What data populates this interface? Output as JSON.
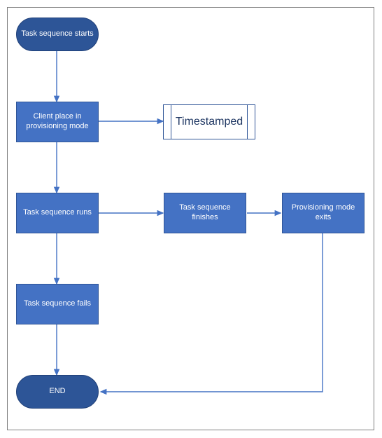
{
  "chart_data": {
    "type": "flowchart",
    "title": "",
    "nodes": [
      {
        "id": "start",
        "shape": "terminator",
        "label": "Task sequence starts"
      },
      {
        "id": "client",
        "shape": "process",
        "label": "Client place in provisioning mode"
      },
      {
        "id": "timestamp",
        "shape": "data",
        "label": "Timestamped"
      },
      {
        "id": "runs",
        "shape": "process",
        "label": "Task sequence runs"
      },
      {
        "id": "finishes",
        "shape": "process",
        "label": "Task sequence finishes"
      },
      {
        "id": "exits",
        "shape": "process",
        "label": "Provisioning mode exits"
      },
      {
        "id": "fails",
        "shape": "process",
        "label": "Task sequence fails"
      },
      {
        "id": "end",
        "shape": "terminator",
        "label": "END"
      }
    ],
    "edges": [
      {
        "from": "start",
        "to": "client"
      },
      {
        "from": "client",
        "to": "timestamp"
      },
      {
        "from": "client",
        "to": "runs"
      },
      {
        "from": "runs",
        "to": "finishes"
      },
      {
        "from": "finishes",
        "to": "exits"
      },
      {
        "from": "runs",
        "to": "fails"
      },
      {
        "from": "fails",
        "to": "end"
      },
      {
        "from": "exits",
        "to": "end"
      }
    ]
  },
  "colors": {
    "terminator_fill": "#2d5597",
    "process_fill": "#4472c4",
    "border": "#2f5597",
    "arrow": "#4472c4"
  }
}
